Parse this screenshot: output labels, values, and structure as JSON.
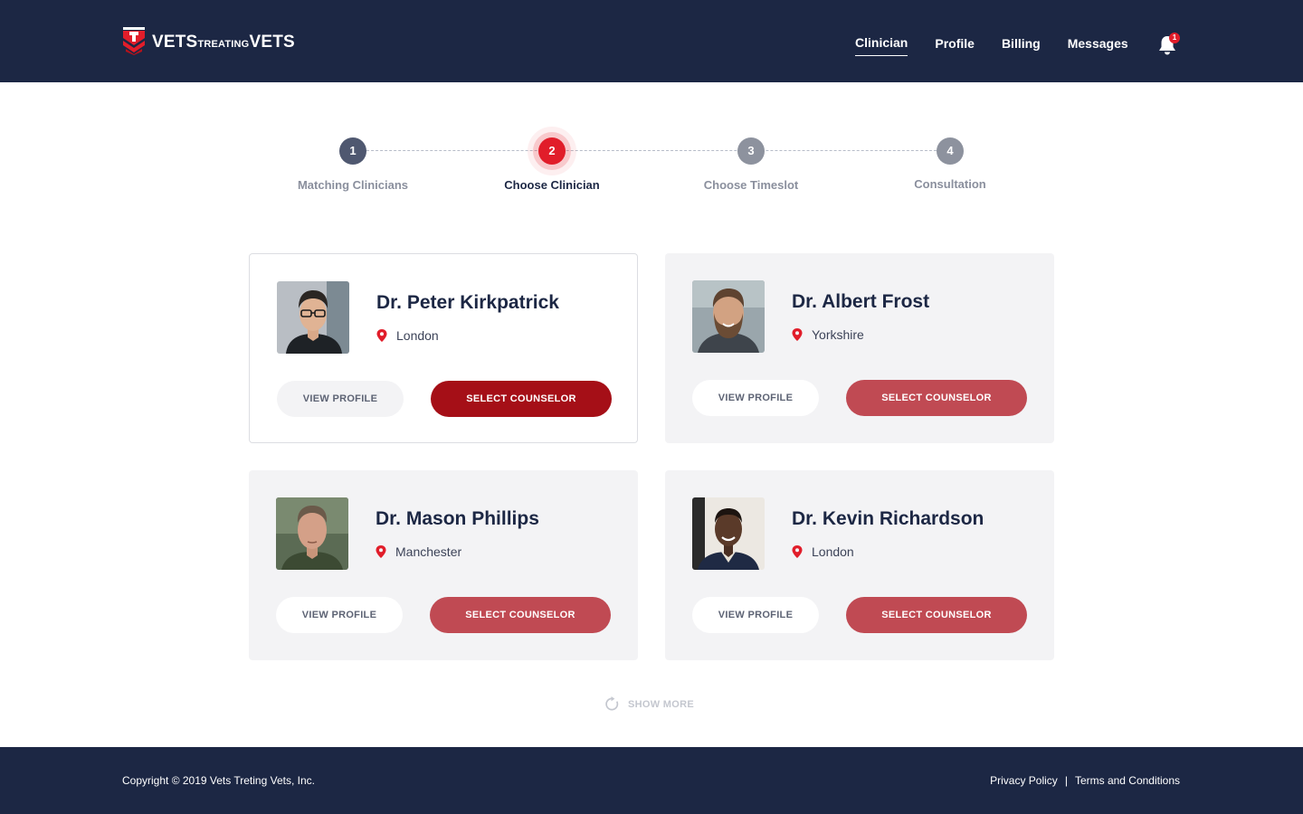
{
  "brand": {
    "logo_text_1": "VETS",
    "logo_text_2": "TREATING",
    "logo_text_3": "VETS",
    "colors": {
      "navy": "#1c2744",
      "red": "#e11d2a",
      "button_red": "#c04a53",
      "button_red_active": "#a50f17"
    }
  },
  "nav": {
    "items": [
      {
        "label": "Clinician",
        "active": true
      },
      {
        "label": "Profile",
        "active": false
      },
      {
        "label": "Billing",
        "active": false
      },
      {
        "label": "Messages",
        "active": false
      }
    ],
    "notification_icon": "bell-icon",
    "notification_count": "1"
  },
  "stepper": {
    "steps": [
      {
        "number": "1",
        "label": "Matching Clinicians",
        "state": "done"
      },
      {
        "number": "2",
        "label": "Choose Clinician",
        "state": "current"
      },
      {
        "number": "3",
        "label": "Choose Timeslot",
        "state": "future"
      },
      {
        "number": "4",
        "label": "Consultation",
        "state": "future"
      }
    ]
  },
  "clinicians": [
    {
      "name": "Dr. Peter Kirkpatrick",
      "location": "London",
      "selected": true,
      "view_label": "VIEW PROFILE",
      "select_label": "SELECT COUNSELOR"
    },
    {
      "name": "Dr. Albert Frost",
      "location": "Yorkshire",
      "selected": false,
      "view_label": "VIEW PROFILE",
      "select_label": "SELECT COUNSELOR"
    },
    {
      "name": "Dr. Mason Phillips",
      "location": "Manchester",
      "selected": false,
      "view_label": "VIEW PROFILE",
      "select_label": "SELECT COUNSELOR"
    },
    {
      "name": "Dr. Kevin Richardson",
      "location": "London",
      "selected": false,
      "view_label": "VIEW PROFILE",
      "select_label": "SELECT COUNSELOR"
    }
  ],
  "show_more": {
    "label": "SHOW MORE",
    "icon": "refresh-icon"
  },
  "footer": {
    "copyright": "Copyright © 2019 Vets Treting Vets, Inc.",
    "links": [
      "Privacy Policy",
      "Terms and Conditions"
    ],
    "separator": "|"
  }
}
